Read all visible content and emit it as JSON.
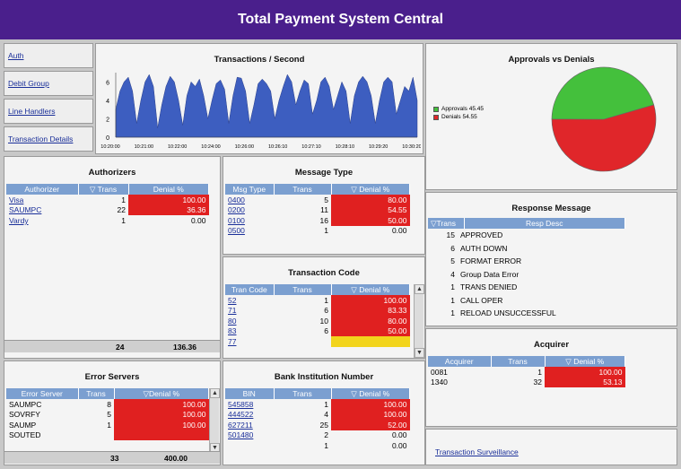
{
  "title": "Total Payment System Central",
  "nav": [
    {
      "label": "Auth"
    },
    {
      "label": "Debit Group"
    },
    {
      "label": "Line Handlers"
    },
    {
      "label": "Transaction Details"
    }
  ],
  "tps": {
    "title": "Transactions / Second",
    "yticks": [
      "6",
      "4",
      "2",
      "0"
    ],
    "xticks": [
      "10:20:00",
      "10:21:00",
      "10:22:00",
      "10:24:00",
      "10:26:00",
      "10:26:10",
      "10:27:10",
      "10:28:10",
      "10:29:20",
      "10:30:20"
    ],
    "color": "#3d5ec0"
  },
  "chart_data": [
    {
      "type": "area",
      "title": "Transactions / Second",
      "ylim": [
        0,
        7
      ],
      "values": [
        3,
        5,
        6,
        6.5,
        5,
        1.5,
        4,
        6,
        6.8,
        5.5,
        1,
        3.5,
        5.5,
        6.6,
        6,
        4,
        1.3,
        4.5,
        6,
        5.5,
        6.3,
        4.5,
        2,
        4,
        5.8,
        6.2,
        5.2,
        1.5,
        4.5,
        6.5,
        6.4,
        5,
        1.5,
        3.5,
        5.8,
        6.3,
        5.8,
        5,
        2,
        4,
        5.5,
        6.8,
        6,
        3.5,
        5,
        6.2,
        5.8,
        2.5,
        4,
        6,
        6.5,
        5.5,
        3,
        4.5,
        6,
        5,
        1.5,
        4.5,
        6,
        6.6,
        6,
        4.5,
        1.5,
        4,
        6,
        6.5,
        6,
        2.5,
        4,
        5.5,
        5,
        6.5,
        4
      ]
    },
    {
      "type": "pie",
      "title": "Approvals vs Denials",
      "labels": [
        "Approvals 45.45",
        "Denials 54.55"
      ],
      "values": [
        45.45,
        54.55
      ],
      "colors": [
        "#44c03c",
        "#e0262a"
      ]
    }
  ],
  "approvals": {
    "title": "Approvals vs Denials",
    "legend": [
      {
        "label": "Approvals 45.45",
        "color": "#44c03c"
      },
      {
        "label": "Denials 54.55",
        "color": "#e0262a"
      }
    ]
  },
  "authorizers": {
    "title": "Authorizers",
    "headers": [
      "Authorizer",
      "Trans",
      "Denial %"
    ],
    "rows": [
      {
        "name": "Visa",
        "trans": "1",
        "denial": "100.00",
        "hl": "red"
      },
      {
        "name": "SAUMPC",
        "trans": "22",
        "denial": "36.36",
        "hl": "red"
      },
      {
        "name": "Vardy",
        "trans": "1",
        "denial": "0.00",
        "hl": ""
      }
    ],
    "total_trans": "24",
    "total_denial": "136.36"
  },
  "message_type": {
    "title": "Message Type",
    "headers": [
      "Msg Type",
      "Trans",
      "Denial %"
    ],
    "rows": [
      {
        "name": "0400",
        "trans": "5",
        "denial": "80.00",
        "hl": "red"
      },
      {
        "name": "0200",
        "trans": "11",
        "denial": "54.55",
        "hl": "red"
      },
      {
        "name": "0100",
        "trans": "16",
        "denial": "50.00",
        "hl": "red"
      },
      {
        "name": "0500",
        "trans": "1",
        "denial": "0.00",
        "hl": ""
      }
    ]
  },
  "tran_code": {
    "title": "Transaction Code",
    "headers": [
      "Tran Code",
      "Trans",
      "Denial %"
    ],
    "rows": [
      {
        "name": "52",
        "trans": "1",
        "denial": "100.00",
        "hl": "red"
      },
      {
        "name": "71",
        "trans": "6",
        "denial": "83.33",
        "hl": "red"
      },
      {
        "name": "80",
        "trans": "10",
        "denial": "80.00",
        "hl": "red"
      },
      {
        "name": "83",
        "trans": "6",
        "denial": "50.00",
        "hl": "red"
      },
      {
        "name": "77",
        "trans": "",
        "denial": "",
        "hl": "yel"
      }
    ]
  },
  "response": {
    "title": "Response Message",
    "headers": [
      "Trans",
      "Resp Desc"
    ],
    "rows": [
      {
        "trans": "15",
        "desc": "APPROVED"
      },
      {
        "trans": "6",
        "desc": "AUTH DOWN"
      },
      {
        "trans": "5",
        "desc": "FORMAT ERROR"
      },
      {
        "trans": "4",
        "desc": "Group Data Error"
      },
      {
        "trans": "1",
        "desc": "TRANS DENIED"
      },
      {
        "trans": "1",
        "desc": "CALL OPER"
      },
      {
        "trans": "1",
        "desc": "RELOAD UNSUCCESSFUL"
      }
    ]
  },
  "acquirer": {
    "title": "Acquirer",
    "headers": [
      "Acquirer",
      "Trans",
      "Denial %"
    ],
    "rows": [
      {
        "name": "0081",
        "trans": "1",
        "denial": "100.00",
        "hl": "red"
      },
      {
        "name": "1340",
        "trans": "32",
        "denial": "53.13",
        "hl": "red"
      }
    ]
  },
  "error_servers": {
    "title": "Error Servers",
    "headers": [
      "Error Server",
      "Trans",
      "Denial %"
    ],
    "rows": [
      {
        "name": "SAUMPC",
        "trans": "8",
        "denial": "100.00",
        "hl": "red"
      },
      {
        "name": "SOVRFY",
        "trans": "5",
        "denial": "100.00",
        "hl": "red"
      },
      {
        "name": "SAUMP",
        "trans": "1",
        "denial": "100.00",
        "hl": "red"
      },
      {
        "name": "SOUTED",
        "trans": "",
        "denial": "",
        "hl": "red"
      }
    ],
    "total_trans": "33",
    "total_denial": "400.00"
  },
  "bin": {
    "title": "Bank Institution Number",
    "headers": [
      "BIN",
      "Trans",
      "Denial %"
    ],
    "rows": [
      {
        "name": "545858",
        "trans": "1",
        "denial": "100.00",
        "hl": "red"
      },
      {
        "name": "444522",
        "trans": "4",
        "denial": "100.00",
        "hl": "red"
      },
      {
        "name": "627211",
        "trans": "25",
        "denial": "52.00",
        "hl": "red"
      },
      {
        "name": "501480",
        "trans": "2",
        "denial": "0.00",
        "hl": ""
      },
      {
        "name": "",
        "trans": "1",
        "denial": "0.00",
        "hl": ""
      }
    ]
  },
  "surveillance": {
    "label": "Transaction Surveillance"
  }
}
